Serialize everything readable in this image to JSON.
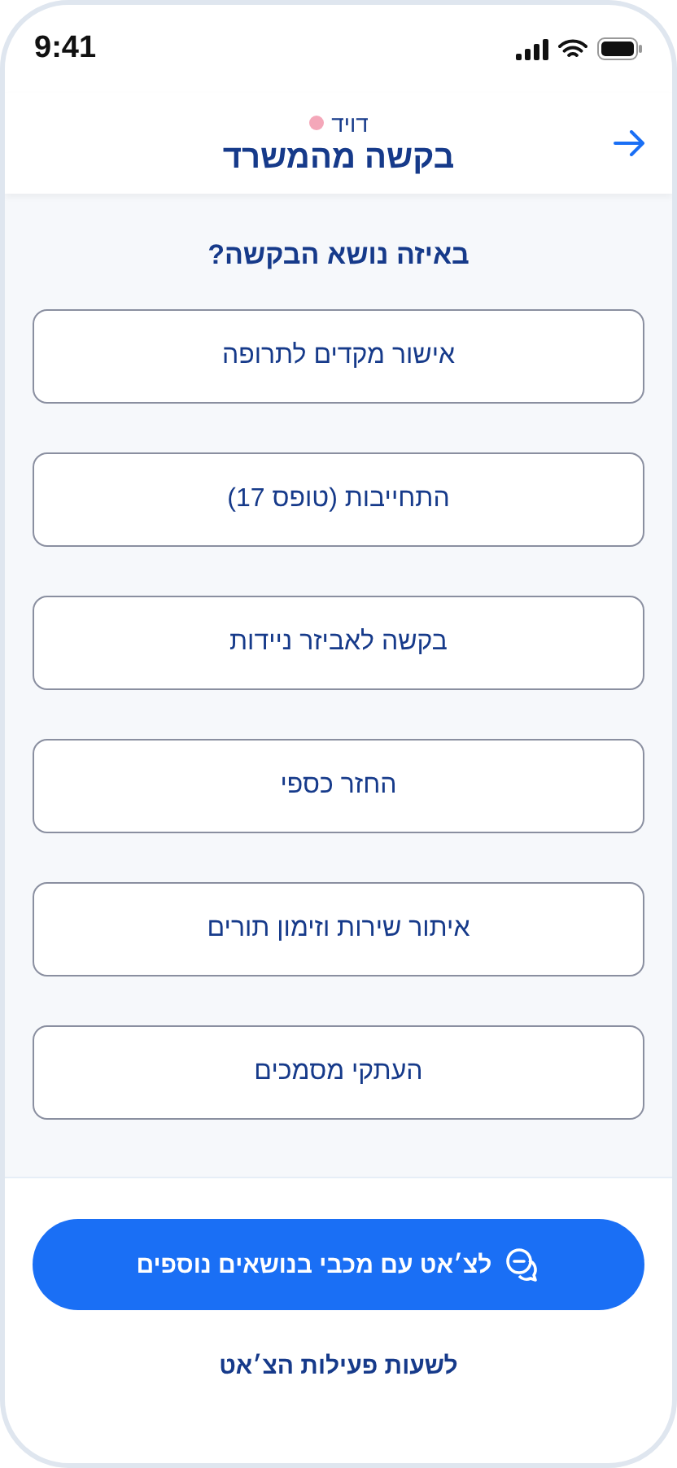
{
  "status_bar": {
    "time": "9:41"
  },
  "header": {
    "user_name": "דויד",
    "title": "בקשה מהמשרד"
  },
  "question": "באיזה נושא הבקשה?",
  "topics": [
    "אישור מקדים לתרופה",
    "התחייבות (טופס 17)",
    "בקשה לאביזר ניידות",
    "החזר כספי",
    "איתור שירות וזימון תורים",
    "העתקי מסמכים"
  ],
  "chat_button": "לצ׳אט עם מכבי בנושאים נוספים",
  "hours_link": "לשעות פעילות הצ׳אט"
}
